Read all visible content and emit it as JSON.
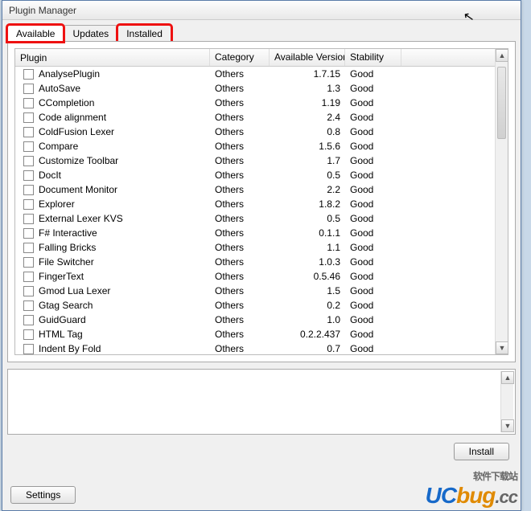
{
  "window": {
    "title": "Plugin Manager"
  },
  "tabs": [
    {
      "label": "Available",
      "active": true,
      "highlighted": true
    },
    {
      "label": "Updates",
      "active": false,
      "highlighted": false
    },
    {
      "label": "Installed",
      "active": false,
      "highlighted": true
    }
  ],
  "columns": {
    "plugin": "Plugin",
    "category": "Category",
    "version": "Available Version",
    "stability": "Stability"
  },
  "plugins": [
    {
      "name": "AnalysePlugin",
      "category": "Others",
      "version": "1.7.15",
      "stability": "Good"
    },
    {
      "name": "AutoSave",
      "category": "Others",
      "version": "1.3",
      "stability": "Good"
    },
    {
      "name": "CCompletion",
      "category": "Others",
      "version": "1.19",
      "stability": "Good"
    },
    {
      "name": "Code alignment",
      "category": "Others",
      "version": "2.4",
      "stability": "Good"
    },
    {
      "name": "ColdFusion Lexer",
      "category": "Others",
      "version": "0.8",
      "stability": "Good"
    },
    {
      "name": "Compare",
      "category": "Others",
      "version": "1.5.6",
      "stability": "Good"
    },
    {
      "name": "Customize Toolbar",
      "category": "Others",
      "version": "1.7",
      "stability": "Good"
    },
    {
      "name": "DocIt",
      "category": "Others",
      "version": "0.5",
      "stability": "Good"
    },
    {
      "name": "Document Monitor",
      "category": "Others",
      "version": "2.2",
      "stability": "Good"
    },
    {
      "name": "Explorer",
      "category": "Others",
      "version": "1.8.2",
      "stability": "Good"
    },
    {
      "name": "External Lexer KVS",
      "category": "Others",
      "version": "0.5",
      "stability": "Good"
    },
    {
      "name": "F# Interactive",
      "category": "Others",
      "version": "0.1.1",
      "stability": "Good"
    },
    {
      "name": "Falling Bricks",
      "category": "Others",
      "version": "1.1",
      "stability": "Good"
    },
    {
      "name": "File Switcher",
      "category": "Others",
      "version": "1.0.3",
      "stability": "Good"
    },
    {
      "name": "FingerText",
      "category": "Others",
      "version": "0.5.46",
      "stability": "Good"
    },
    {
      "name": "Gmod Lua Lexer",
      "category": "Others",
      "version": "1.5",
      "stability": "Good"
    },
    {
      "name": "Gtag Search",
      "category": "Others",
      "version": "0.2",
      "stability": "Good"
    },
    {
      "name": "GuidGuard",
      "category": "Others",
      "version": "1.0",
      "stability": "Good"
    },
    {
      "name": "HTML Tag",
      "category": "Others",
      "version": "0.2.2.437",
      "stability": "Good"
    },
    {
      "name": "Indent By Fold",
      "category": "Others",
      "version": "0.7",
      "stability": "Good"
    }
  ],
  "buttons": {
    "install": "Install",
    "settings": "Settings"
  },
  "watermark": {
    "sub": "软件下载站",
    "brand_uc": "UC",
    "brand_bug": "bug",
    "brand_cc": ".cc"
  }
}
